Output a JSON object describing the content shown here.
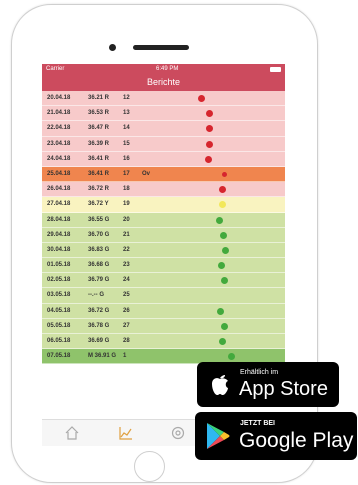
{
  "status": {
    "carrier": "Carrier",
    "time": "6:49 PM"
  },
  "header": {
    "title": "Berichte"
  },
  "colors": {
    "red_zone": "#f7caca",
    "orange_row": "#f0854e",
    "yellow_zone": "#f9f3c0",
    "green_zone": "#cfe1a4",
    "dark_green_row": "#8fc36b",
    "header": "#cc4b5e"
  },
  "rows": [
    {
      "date": "20.04.18",
      "value": "36.21 R",
      "cycle": "12",
      "note": "",
      "zone": "red",
      "dot": "red"
    },
    {
      "date": "21.04.18",
      "value": "36.53 R",
      "cycle": "13",
      "note": "",
      "zone": "red",
      "dot": "red"
    },
    {
      "date": "22.04.18",
      "value": "36.47 R",
      "cycle": "14",
      "note": "",
      "zone": "red",
      "dot": "red"
    },
    {
      "date": "23.04.18",
      "value": "36.39 R",
      "cycle": "15",
      "note": "",
      "zone": "red",
      "dot": "red"
    },
    {
      "date": "24.04.18",
      "value": "36.41 R",
      "cycle": "16",
      "note": "",
      "zone": "red",
      "dot": "red"
    },
    {
      "date": "25.04.18",
      "value": "36.41 R",
      "cycle": "17",
      "note": "Ov",
      "zone": "orange",
      "dot": "red"
    },
    {
      "date": "26.04.18",
      "value": "36.72 R",
      "cycle": "18",
      "note": "",
      "zone": "red",
      "dot": "red"
    },
    {
      "date": "27.04.18",
      "value": "36.72 Y",
      "cycle": "19",
      "note": "",
      "zone": "yellow",
      "dot": "yellow"
    },
    {
      "date": "28.04.18",
      "value": "36.55 G",
      "cycle": "20",
      "note": "",
      "zone": "green",
      "dot": "green"
    },
    {
      "date": "29.04.18",
      "value": "36.70 G",
      "cycle": "21",
      "note": "",
      "zone": "green",
      "dot": "green"
    },
    {
      "date": "30.04.18",
      "value": "36.83 G",
      "cycle": "22",
      "note": "",
      "zone": "green",
      "dot": "green"
    },
    {
      "date": "01.05.18",
      "value": "36.68 G",
      "cycle": "23",
      "note": "",
      "zone": "green",
      "dot": "green"
    },
    {
      "date": "02.05.18",
      "value": "36.79 G",
      "cycle": "24",
      "note": "",
      "zone": "green",
      "dot": "green"
    },
    {
      "date": "03.05.18",
      "value": "--.-- G",
      "cycle": "25",
      "note": "",
      "zone": "green",
      "dot": "none"
    },
    {
      "date": "04.05.18",
      "value": "36.72 G",
      "cycle": "26",
      "note": "",
      "zone": "green",
      "dot": "green"
    },
    {
      "date": "05.05.18",
      "value": "36.78 G",
      "cycle": "27",
      "note": "",
      "zone": "green",
      "dot": "green"
    },
    {
      "date": "06.05.18",
      "value": "36.69 G",
      "cycle": "28",
      "note": "",
      "zone": "green",
      "dot": "green"
    },
    {
      "date": "07.05.18",
      "value": "M 36.91 G",
      "cycle": "1",
      "note": "",
      "zone": "darkgreen",
      "dot": "green"
    }
  ],
  "badges": {
    "appstore": {
      "small": "Erhältlich im",
      "big": "App Store"
    },
    "googleplay": {
      "small": "JETZT BEI",
      "big": "Google Play"
    }
  },
  "tabs": [
    "home-icon",
    "chart-icon",
    "settings-icon"
  ]
}
